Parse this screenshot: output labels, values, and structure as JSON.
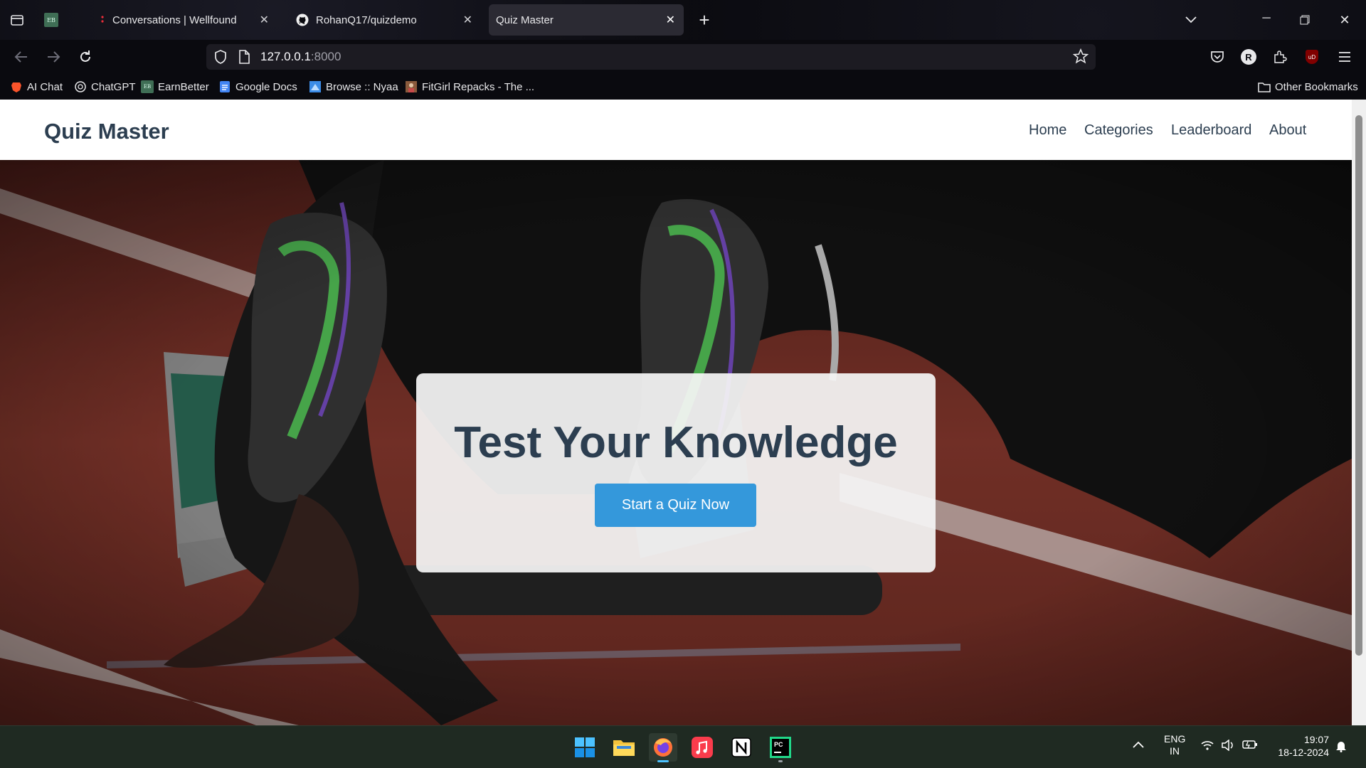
{
  "browser": {
    "tabs": [
      {
        "label": "",
        "icon": "earnbetter-icon"
      },
      {
        "label": "Conversations | Wellfound",
        "icon": "wellfound-icon"
      },
      {
        "label": "RohanQ17/quizdemo",
        "icon": "github-icon"
      },
      {
        "label": "Quiz Master",
        "icon": ""
      }
    ],
    "url": {
      "host": "127.0.0.1",
      "port": ":8000"
    },
    "bookmarks": [
      {
        "label": "AI Chat",
        "icon": "brave-icon"
      },
      {
        "label": "ChatGPT",
        "icon": "openai-icon"
      },
      {
        "label": "EarnBetter",
        "icon": "earnbetter-icon"
      },
      {
        "label": "Google Docs",
        "icon": "docs-icon"
      },
      {
        "label": "Browse :: Nyaa",
        "icon": "nyaa-icon"
      },
      {
        "label": "FitGirl Repacks - The ...",
        "icon": "fitgirl-icon"
      }
    ],
    "other_bookmarks": "Other Bookmarks",
    "eb_badge": "EB",
    "profile_initial": "R",
    "ublock_label": "uD"
  },
  "site": {
    "brand": "Quiz Master",
    "nav": [
      "Home",
      "Categories",
      "Leaderboard",
      "About"
    ],
    "hero_title": "Test Your Knowledge",
    "cta_label": "Start a Quiz Now",
    "colors": {
      "primary": "#2c3e50",
      "accent": "#3498db"
    }
  },
  "taskbar": {
    "lang_top": "ENG",
    "lang_bottom": "IN",
    "time": "19:07",
    "date": "18-12-2024"
  }
}
